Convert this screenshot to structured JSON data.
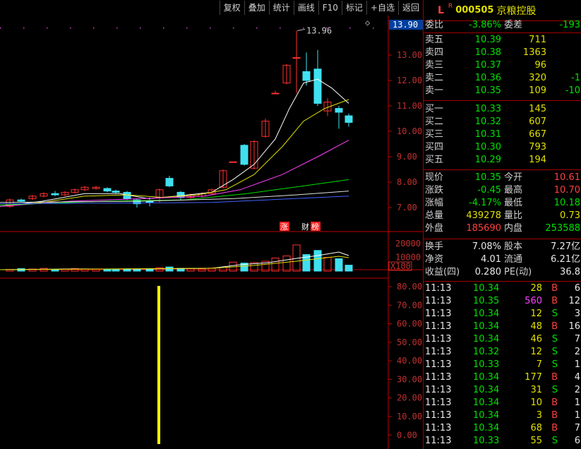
{
  "toolbar": [
    "复权",
    "叠加",
    "统计",
    "画线",
    "F10",
    "标记",
    "+自选",
    "返回"
  ],
  "header": {
    "mark": "L",
    "sup": "R",
    "code": "000505",
    "name": "京粮控股"
  },
  "chart": {
    "price_axis": [
      "13.00",
      "12.00",
      "11.00",
      "10.00",
      "9.00",
      "8.00",
      "7.00"
    ],
    "top_price": "13.90",
    "high_label": "13.96",
    "vol_axis": [
      "20000",
      "10000",
      "X100"
    ],
    "ind_axis": [
      "80.00",
      "70.00",
      "60.00",
      "50.00",
      "40.00",
      "30.00",
      "20.00",
      "10.00",
      "0.00"
    ],
    "flags": [
      "涨",
      "财",
      "榜"
    ]
  },
  "quote": {
    "weibi": {
      "label": "委比",
      "value": "-3.86%",
      "label2": "委差",
      "value2": "-193"
    },
    "sell": [
      {
        "label": "卖五",
        "price": "10.39",
        "vol": "711",
        "chg": ""
      },
      {
        "label": "卖四",
        "price": "10.38",
        "vol": "1363",
        "chg": ""
      },
      {
        "label": "卖三",
        "price": "10.37",
        "vol": "96",
        "chg": ""
      },
      {
        "label": "卖二",
        "price": "10.36",
        "vol": "320",
        "chg": "-1"
      },
      {
        "label": "卖一",
        "price": "10.35",
        "vol": "109",
        "chg": "-10"
      }
    ],
    "buy": [
      {
        "label": "买一",
        "price": "10.33",
        "vol": "145"
      },
      {
        "label": "买二",
        "price": "10.32",
        "vol": "607"
      },
      {
        "label": "买三",
        "price": "10.31",
        "vol": "667"
      },
      {
        "label": "买四",
        "price": "10.30",
        "vol": "793"
      },
      {
        "label": "买五",
        "price": "10.29",
        "vol": "194"
      }
    ],
    "stats": [
      {
        "l1": "现价",
        "v1": "10.35",
        "l2": "今开",
        "v2": "10.61",
        "c1": "grn",
        "c2": "red"
      },
      {
        "l1": "涨跌",
        "v1": "-0.45",
        "l2": "最高",
        "v2": "10.70",
        "c1": "grn",
        "c2": "red"
      },
      {
        "l1": "涨幅",
        "v1": "-4.17%",
        "l2": "最低",
        "v2": "10.18",
        "c1": "grn",
        "c2": "grn"
      },
      {
        "l1": "总量",
        "v1": "439278",
        "l2": "量比",
        "v2": "0.73",
        "c1": "yel",
        "c2": "yel"
      },
      {
        "l1": "外盘",
        "v1": "185690",
        "l2": "内盘",
        "v2": "253588",
        "c1": "red",
        "c2": "grn"
      }
    ],
    "stats2": [
      {
        "l1": "换手",
        "v1": "7.08%",
        "l2": "股本",
        "v2": "7.27亿"
      },
      {
        "l1": "净资",
        "v1": "4.01",
        "l2": "流通",
        "v2": "6.21亿"
      },
      {
        "l1": "收益(四)",
        "v1": "0.280",
        "l2": "PE(动)",
        "v2": "36.8"
      }
    ],
    "ticks": [
      {
        "t": "11:13",
        "p": "10.34",
        "v": "28",
        "bs": "B",
        "n": "6"
      },
      {
        "t": "11:13",
        "p": "10.35",
        "v": "560",
        "bs": "B",
        "n": "12"
      },
      {
        "t": "11:13",
        "p": "10.34",
        "v": "12",
        "bs": "S",
        "n": "3"
      },
      {
        "t": "11:13",
        "p": "10.34",
        "v": "48",
        "bs": "B",
        "n": "16"
      },
      {
        "t": "11:13",
        "p": "10.34",
        "v": "46",
        "bs": "S",
        "n": "7"
      },
      {
        "t": "11:13",
        "p": "10.32",
        "v": "12",
        "bs": "S",
        "n": "2"
      },
      {
        "t": "11:13",
        "p": "10.33",
        "v": "7",
        "bs": "S",
        "n": "1"
      },
      {
        "t": "11:13",
        "p": "10.34",
        "v": "177",
        "bs": "B",
        "n": "4"
      },
      {
        "t": "11:13",
        "p": "10.34",
        "v": "31",
        "bs": "S",
        "n": "2"
      },
      {
        "t": "11:13",
        "p": "10.34",
        "v": "10",
        "bs": "B",
        "n": "1"
      },
      {
        "t": "11:13",
        "p": "10.34",
        "v": "3",
        "bs": "B",
        "n": "1"
      },
      {
        "t": "11:13",
        "p": "10.34",
        "v": "68",
        "bs": "B",
        "n": "7"
      },
      {
        "t": "11:13",
        "p": "10.33",
        "v": "55",
        "bs": "S",
        "n": "6"
      }
    ]
  },
  "colors": {
    "up": "#ff3030",
    "down": "#40e0f0",
    "border": "#a00000"
  }
}
